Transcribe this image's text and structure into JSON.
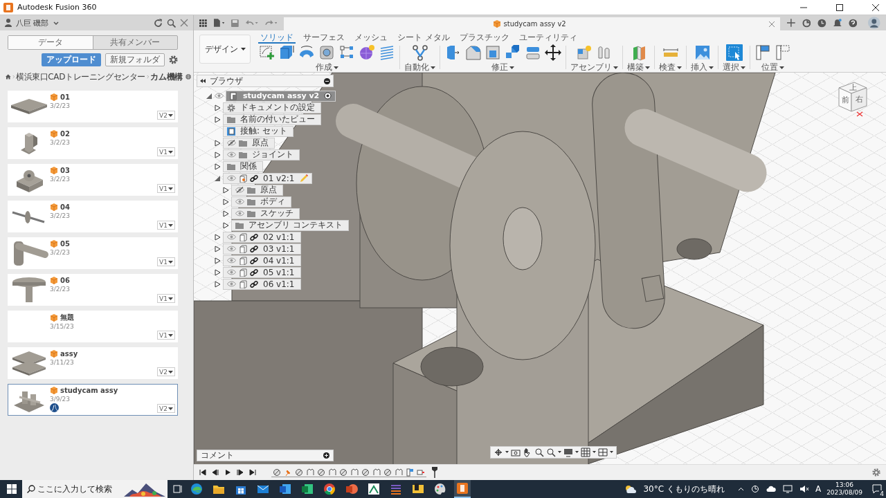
{
  "window": {
    "title": "Autodesk Fusion 360"
  },
  "data_panel": {
    "user": "八巨 磯部",
    "tabs": [
      {
        "label": "データ",
        "selected": true
      },
      {
        "label": "共有メンバー",
        "selected": false
      }
    ],
    "upload_button": "アップロード",
    "new_folder_button": "新規フォルダ",
    "breadcrumb": [
      "横浜東口CADトレーニングセンター",
      "カム機構"
    ],
    "files": [
      {
        "name": "01",
        "date": "3/2/23",
        "version": "V2",
        "kind": "plate",
        "selected": false
      },
      {
        "name": "02",
        "date": "3/2/23",
        "version": "V1",
        "kind": "bracket",
        "selected": false
      },
      {
        "name": "03",
        "date": "3/2/23",
        "version": "V1",
        "kind": "block",
        "selected": false
      },
      {
        "name": "04",
        "date": "3/2/23",
        "version": "V1",
        "kind": "shaft",
        "selected": false
      },
      {
        "name": "05",
        "date": "3/2/23",
        "version": "V1",
        "kind": "lever",
        "selected": false
      },
      {
        "name": "06",
        "date": "3/2/23",
        "version": "V1",
        "kind": "knob",
        "selected": false
      },
      {
        "name": "無題",
        "date": "3/15/23",
        "version": "V1",
        "kind": "untitled",
        "selected": false
      },
      {
        "name": "assy",
        "date": "3/11/23",
        "version": "V2",
        "kind": "plates",
        "selected": false
      },
      {
        "name": "studycam assy",
        "date": "3/9/23",
        "version": "V2",
        "kind": "assembly",
        "selected": true,
        "badge": "八"
      }
    ]
  },
  "document_tab": {
    "title": "studycam assy v2"
  },
  "toolbar": {
    "workspace": "デザイン",
    "tabs": [
      {
        "label": "ソリッド",
        "selected": true
      },
      {
        "label": "サーフェス",
        "selected": false
      },
      {
        "label": "メッシュ",
        "selected": false
      },
      {
        "label": "シート メタル",
        "selected": false
      },
      {
        "label": "プラスチック",
        "selected": false
      },
      {
        "label": "ユーティリティ",
        "selected": false
      }
    ],
    "groups": [
      {
        "label": "作成",
        "active": false
      },
      {
        "label": "自動化",
        "active": false
      },
      {
        "label": "修正",
        "active": false
      },
      {
        "label": "アセンブリ",
        "active": false
      },
      {
        "label": "構築",
        "active": false
      },
      {
        "label": "検査",
        "active": false
      },
      {
        "label": "挿入",
        "active": false
      },
      {
        "label": "選択",
        "active": true
      },
      {
        "label": "位置",
        "active": false
      }
    ]
  },
  "browser": {
    "title": "ブラウザ",
    "tree": [
      {
        "label": "studycam assy v2",
        "kind": "root",
        "expanded": true,
        "visible": true,
        "active": true,
        "children": [
          {
            "label": "ドキュメントの設定",
            "kind": "settings",
            "expanded": false
          },
          {
            "label": "名前の付いたビュー",
            "kind": "folder",
            "expanded": false
          },
          {
            "label": "接触: セット",
            "kind": "contact"
          },
          {
            "label": "原点",
            "kind": "folder",
            "expanded": false,
            "visible": false
          },
          {
            "label": "ジョイント",
            "kind": "folder",
            "expanded": false,
            "visible": true
          },
          {
            "label": "関係",
            "kind": "folder",
            "expanded": false
          },
          {
            "label": "01 v2:1",
            "kind": "component",
            "expanded": true,
            "visible": true,
            "linked": true,
            "editing": true,
            "children": [
              {
                "label": "原点",
                "kind": "folder",
                "expanded": false,
                "visible": false
              },
              {
                "label": "ボディ",
                "kind": "folder",
                "expanded": false,
                "visible": true
              },
              {
                "label": "スケッチ",
                "kind": "folder",
                "expanded": false,
                "visible": true
              },
              {
                "label": "アセンブリ コンテキスト",
                "kind": "folder",
                "expanded": false
              }
            ]
          },
          {
            "label": "02 v1:1",
            "kind": "component",
            "expanded": false,
            "visible": true,
            "linked": true
          },
          {
            "label": "03 v1:1",
            "kind": "component",
            "expanded": false,
            "visible": true,
            "linked": true
          },
          {
            "label": "04 v1:1",
            "kind": "component",
            "expanded": false,
            "visible": true,
            "linked": true
          },
          {
            "label": "05 v1:1",
            "kind": "component",
            "expanded": false,
            "visible": true,
            "linked": true
          },
          {
            "label": "06 v1:1",
            "kind": "component",
            "expanded": false,
            "visible": true,
            "linked": true
          }
        ]
      }
    ]
  },
  "view_cube": {
    "faces": [
      "上",
      "前",
      "右"
    ]
  },
  "comments": {
    "title": "コメント"
  },
  "taskbar": {
    "search_placeholder": "ここに入力して検索",
    "apps": [
      {
        "kind": "edge",
        "active": false
      },
      {
        "kind": "explorer",
        "active": false
      },
      {
        "kind": "store",
        "active": false
      },
      {
        "kind": "mail",
        "active": false
      },
      {
        "kind": "word",
        "active": false
      },
      {
        "kind": "excel",
        "active": false
      },
      {
        "kind": "chrome",
        "active": false
      },
      {
        "kind": "powerpoint",
        "active": false
      },
      {
        "kind": "chart",
        "active": false
      },
      {
        "kind": "stripes",
        "active": false
      },
      {
        "kind": "viewer",
        "active": false
      },
      {
        "kind": "paint",
        "active": false
      },
      {
        "kind": "fusion",
        "active": true
      }
    ],
    "weather": "30°C くもりのち晴れ",
    "ime": "A",
    "time": "13:06",
    "date": "2023/08/09",
    "notifications": "4"
  }
}
